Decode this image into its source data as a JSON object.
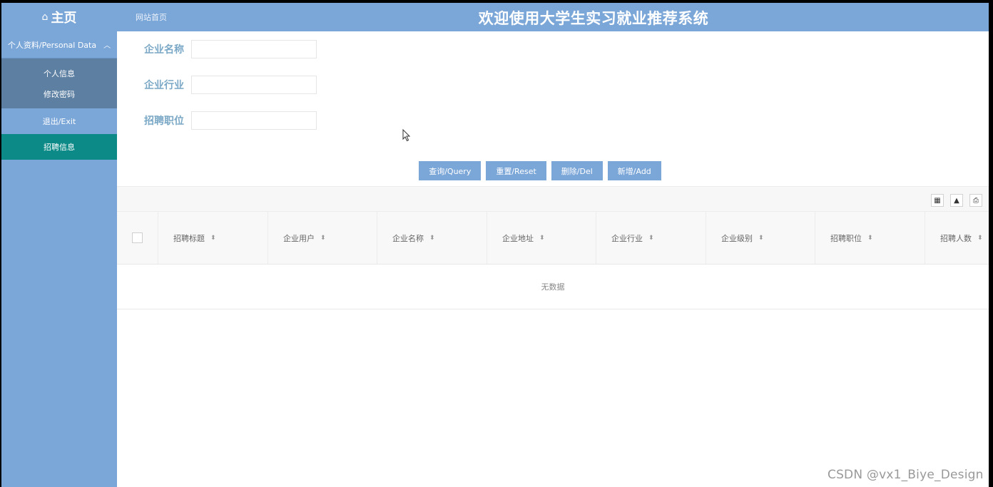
{
  "header": {
    "home_label": "主页",
    "home_icon": "home-icon",
    "breadcrumb": "网站首页",
    "title": "欢迎使用大学生实习就业推荐系统"
  },
  "sidebar": {
    "group_label": "个人资料/Personal Data",
    "group_icon": "chevron-up-icon",
    "sub_items": [
      {
        "label": "个人信息"
      },
      {
        "label": "修改密码"
      }
    ],
    "items": [
      {
        "label": "退出/Exit",
        "active": false
      },
      {
        "label": "招聘信息",
        "active": true
      }
    ]
  },
  "search": {
    "fields": [
      {
        "label": "企业名称",
        "value": "",
        "placeholder": ""
      },
      {
        "label": "企业行业",
        "value": "",
        "placeholder": ""
      },
      {
        "label": "招聘职位",
        "value": "",
        "placeholder": ""
      }
    ]
  },
  "buttons": {
    "query": "查询/Query",
    "reset": "重置/Reset",
    "delete": "删除/Del",
    "add": "新增/Add"
  },
  "toolbar": {
    "icons": [
      "columns-icon",
      "export-icon",
      "print-icon"
    ]
  },
  "table": {
    "columns": [
      "招聘标题",
      "企业用户",
      "企业名称",
      "企业地址",
      "企业行业",
      "企业级别",
      "招聘职位",
      "招聘人数"
    ],
    "empty_text": "无数据"
  },
  "colors": {
    "header": "#7ba6d8",
    "sidebar": "#7ba6d8",
    "submenu": "#5c7fa2",
    "active_item": "#0c8a87",
    "button": "#7ba6d8",
    "label": "#7aa8c6"
  },
  "watermark": "CSDN @vx1_Biye_Design"
}
